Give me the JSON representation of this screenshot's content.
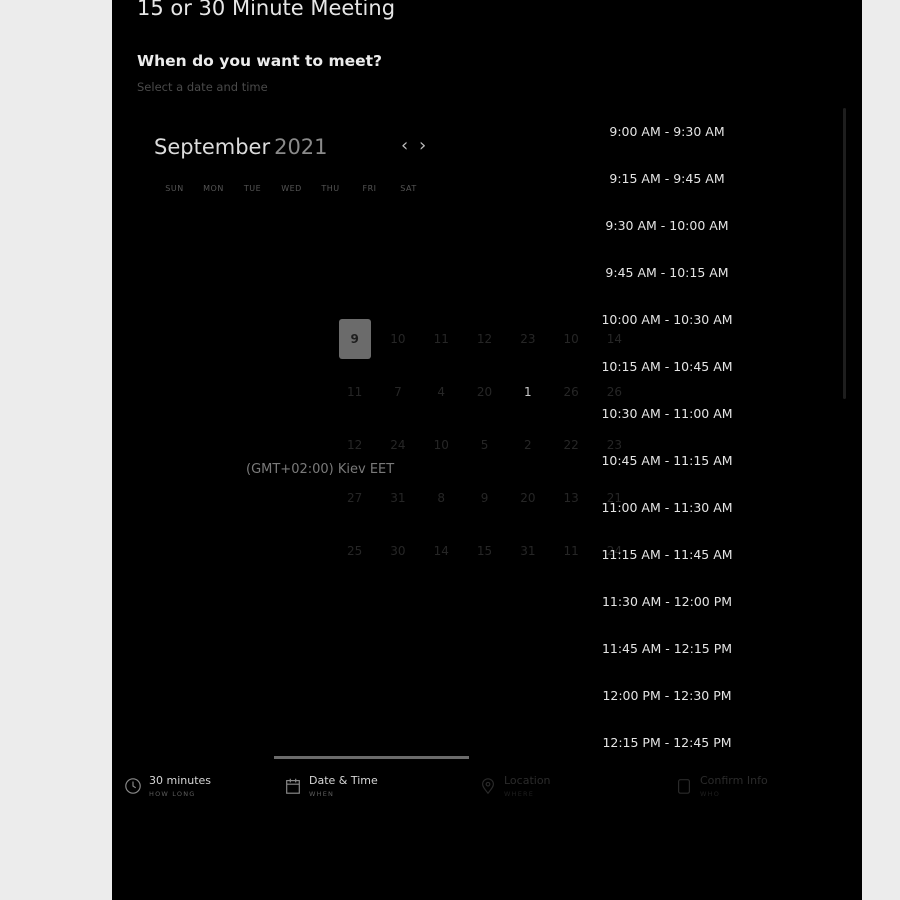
{
  "header": {
    "title": "15 or 30 Minute Meeting",
    "question": "When do you want to meet?",
    "subtitle": "Select a date and time"
  },
  "calendar": {
    "month": "September",
    "year": "2021",
    "weekdays": [
      "SUN",
      "MON",
      "TUE",
      "WED",
      "THU",
      "FRI",
      "SAT"
    ],
    "days": [
      [
        "9",
        "10",
        "11",
        "12",
        "23",
        "10",
        "14"
      ],
      [
        "11",
        "7",
        "4",
        "20",
        "1",
        "26",
        "26"
      ],
      [
        "12",
        "24",
        "10",
        "5",
        "2",
        "22",
        "23"
      ],
      [
        "27",
        "31",
        "8",
        "9",
        "20",
        "13",
        "21"
      ],
      [
        "25",
        "30",
        "14",
        "15",
        "31",
        "11",
        "24"
      ]
    ],
    "selected_day": "9",
    "bright_day": "1"
  },
  "timezone": "(GMT+02:00) Kiev EET",
  "time_slots": [
    "9:00 AM - 9:30 AM",
    "9:15 AM - 9:45 AM",
    "9:30 AM - 10:00 AM",
    "9:45 AM - 10:15 AM",
    "10:00 AM - 10:30 AM",
    "10:15 AM - 10:45 AM",
    "10:30 AM - 11:00 AM",
    "10:45 AM - 11:15 AM",
    "11:00 AM - 11:30 AM",
    "11:15 AM - 11:45 AM",
    "11:30 AM - 12:00 PM",
    "11:45 AM - 12:15 PM",
    "12:00 PM - 12:30 PM",
    "12:15 PM - 12:45 PM"
  ],
  "steps": [
    {
      "title": "30 minutes",
      "sub": "HOW LONG",
      "icon": "clock-icon",
      "active": false
    },
    {
      "title": "Date & Time",
      "sub": "WHEN",
      "icon": "calendar-icon",
      "active": true
    },
    {
      "title": "Location",
      "sub": "WHERE",
      "icon": "location-pin-icon",
      "active": false
    },
    {
      "title": "Confirm Info",
      "sub": "WHO",
      "icon": "contact-card-icon",
      "active": false
    }
  ],
  "colors": {
    "panel_background": "#000000",
    "page_background": "#ececec",
    "selected_day": "#6b6b6b"
  }
}
